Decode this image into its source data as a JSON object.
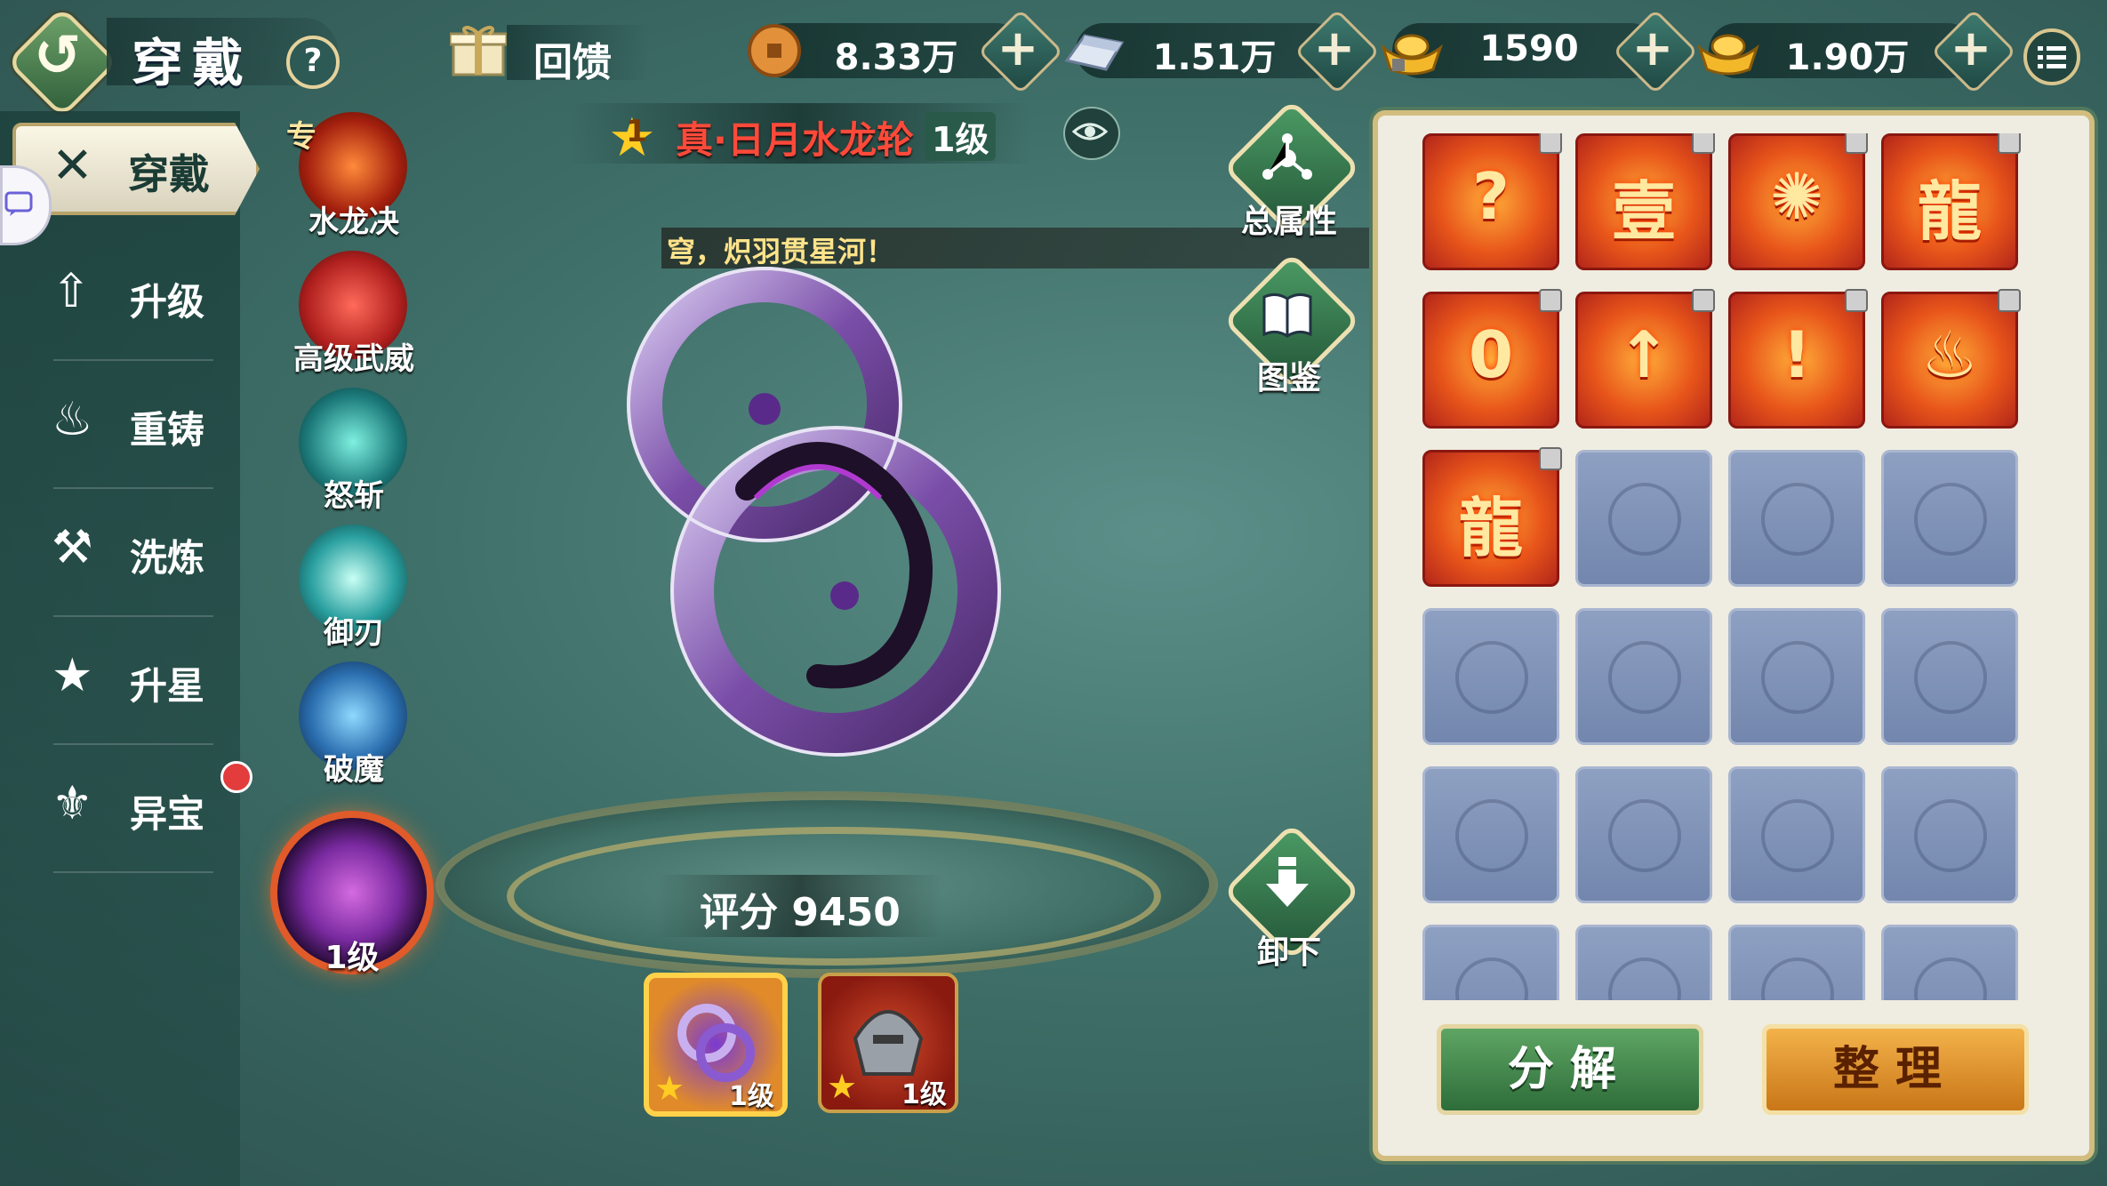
{
  "header": {
    "title": "穿戴",
    "help_glyph": "?",
    "back_glyph": "↺",
    "gift_label": "回馈"
  },
  "currencies": [
    {
      "icon": "copper-coin-icon",
      "value": "8.33万"
    },
    {
      "icon": "silver-ingot-icon",
      "value": "1.51万"
    },
    {
      "icon": "gold-ingot-icon",
      "value": "1590"
    },
    {
      "icon": "gold-yuanbao-icon",
      "value": "1.90万"
    }
  ],
  "plus_glyph": "+",
  "sidebar": {
    "active_tab": {
      "label": "穿戴",
      "icon_glyph": "✕"
    },
    "items": [
      {
        "label": "升级",
        "icon_glyph": "⇧"
      },
      {
        "label": "重铸",
        "icon_glyph": "♨"
      },
      {
        "label": "洗炼",
        "icon_glyph": "⚒"
      },
      {
        "label": "升星",
        "icon_glyph": "★"
      },
      {
        "label": "异宝",
        "icon_glyph": "⚜"
      }
    ]
  },
  "skills": {
    "special_tag": "专",
    "items": [
      {
        "label": "水龙决",
        "color": "#c63a1c"
      },
      {
        "label": "高级武威",
        "color": "#d23a2a"
      },
      {
        "label": "怒斩",
        "color": "#1c8a8a"
      },
      {
        "label": "御刃",
        "color": "#2aa0a0"
      },
      {
        "label": "破魔",
        "color": "#2b6fb0"
      }
    ],
    "main_level": "1级"
  },
  "item": {
    "star": "1",
    "name": "真·日月水龙轮",
    "level": "1级",
    "slogan": "穹，炽羽贯星河！",
    "score": "评分 9450"
  },
  "equip_slots": [
    {
      "star": "1",
      "level": "1级"
    },
    {
      "star": "1",
      "level": "1级"
    }
  ],
  "side_buttons": {
    "total_attr": "总属性",
    "codex": "图鉴",
    "unequip": "卸下"
  },
  "inventory": {
    "items": [
      "?",
      "壹",
      "✺",
      "龍",
      "0",
      "↑",
      "!",
      "♨",
      "龍"
    ],
    "empty_count": 15,
    "decompose_label": "分解",
    "sort_label": "整理"
  }
}
